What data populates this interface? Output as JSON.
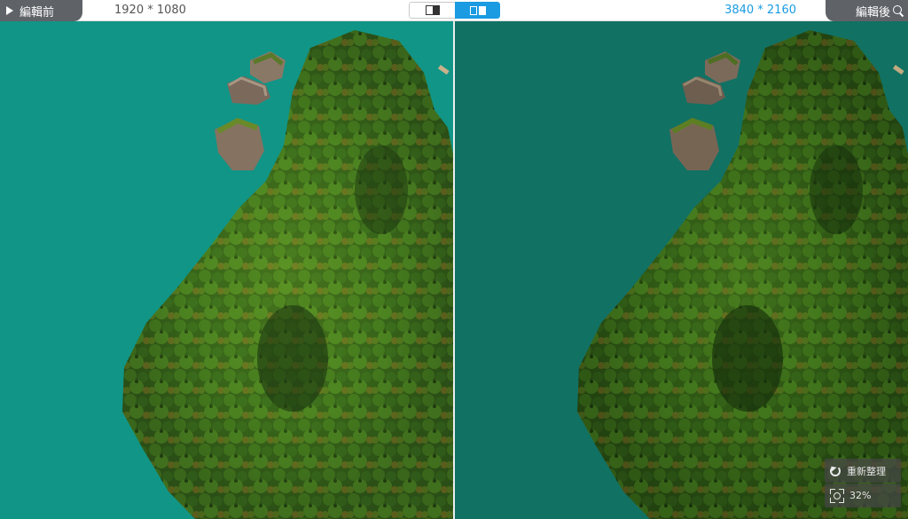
{
  "header": {
    "before_label": "編輯前",
    "after_label": "編輯後",
    "before_resolution": "1920 * 1080",
    "after_resolution": "3840 * 2160",
    "view_modes": [
      "split-view",
      "side-by-side"
    ],
    "active_view_mode": "side-by-side"
  },
  "controls": {
    "reset_label": "重新整理",
    "zoom_level": "32%"
  },
  "colors": {
    "accent": "#1a9be2",
    "tab_bg": "#5f6368",
    "water_before": "#13998a",
    "water_after": "#127566"
  }
}
